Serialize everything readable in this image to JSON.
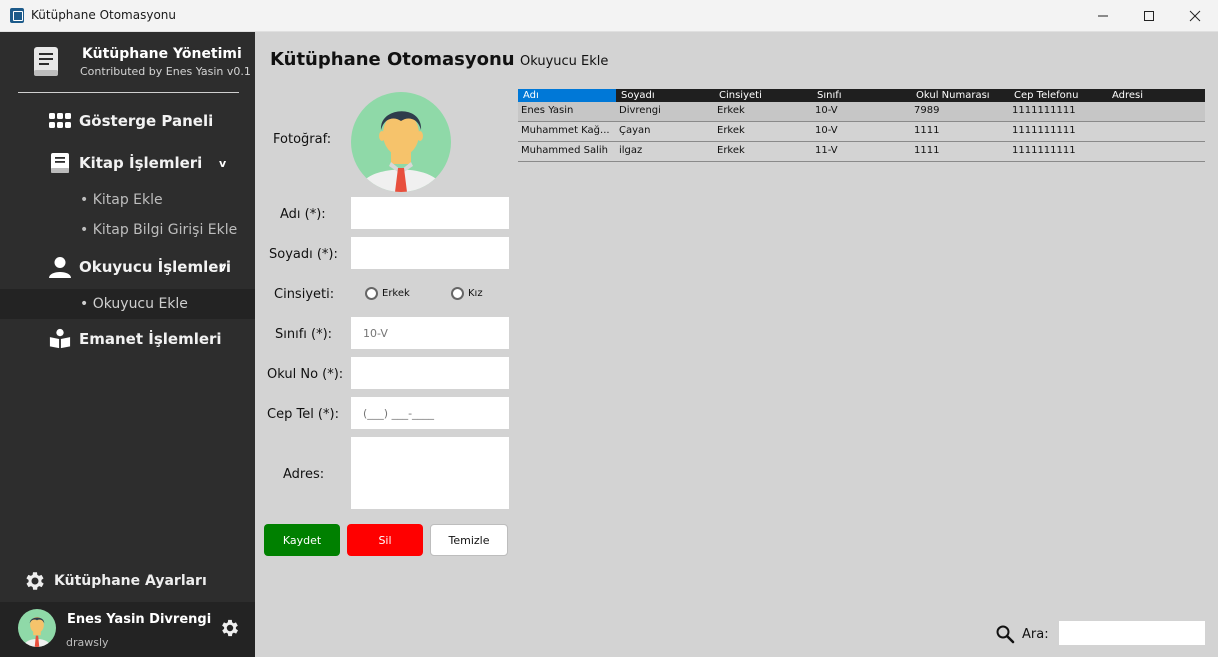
{
  "window": {
    "title": "Kütüphane Otomasyonu",
    "min_glyph": "—",
    "max_glyph": "☐",
    "close_glyph": "✕"
  },
  "sidebar": {
    "brand_title": "Kütüphane Yönetimi",
    "brand_subtitle": "Contributed by Enes Yasin v0.1",
    "nav": [
      {
        "label": "Gösterge Paneli",
        "icon": "dashboard-grid-icon"
      },
      {
        "label": "Kitap İşlemleri",
        "icon": "book-icon",
        "chevron": "v"
      },
      {
        "label": "Okuyucu İşlemleri",
        "icon": "user-icon",
        "chevron": "v"
      },
      {
        "label": "Emanet İşlemleri",
        "icon": "reader-icon"
      }
    ],
    "book_sub": [
      "• Kitap Ekle",
      "• Kitap Bilgi Girişi Ekle"
    ],
    "reader_sub": [
      "• Okuyucu Ekle"
    ],
    "settings_label": "Kütüphane Ayarları",
    "user_name": "Enes Yasin Divrengi",
    "user_handle": "drawsly"
  },
  "main": {
    "title": "Kütüphane Otomasyonu",
    "subtitle": "Okuyucu Ekle",
    "form": {
      "photo_label": "Fotoğraf:",
      "name_label": "Adı (*):",
      "surname_label": "Soyadı (*):",
      "gender_label": "Cinsiyeti:",
      "gender_male": "Erkek",
      "gender_female": "Kız",
      "class_label": "Sınıfı (*):",
      "class_placeholder": "10-V",
      "school_no_label": "Okul No (*):",
      "phone_label": "Cep Tel (*):",
      "phone_placeholder": "(___) ___-____",
      "address_label": "Adres:"
    },
    "buttons": {
      "save": "Kaydet",
      "delete": "Sil",
      "clear": "Temizle"
    },
    "table": {
      "columns": [
        "Adı",
        "Soyadı",
        "Cinsiyeti",
        "Sınıfı",
        "Okul Numarası",
        "Cep Telefonu",
        "Adresi"
      ],
      "rows": [
        [
          "Enes Yasin",
          "Divrengi",
          "Erkek",
          "10-V",
          "7989",
          "1111111111",
          ""
        ],
        [
          "Muhammet Kağ...",
          "Çayan",
          "Erkek",
          "10-V",
          "1111",
          "1111111111",
          ""
        ],
        [
          "Muhammed Salih",
          "ilgaz",
          "Erkek",
          "11-V",
          "1111",
          "1111111111",
          ""
        ]
      ]
    },
    "search_label": "Ara:"
  }
}
